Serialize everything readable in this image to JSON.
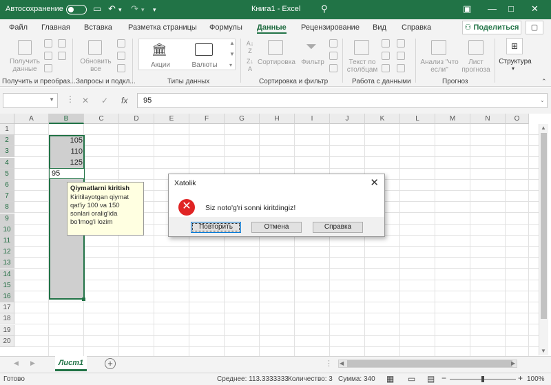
{
  "titlebar": {
    "autosave": "Автосохранение",
    "title": "Книга1  -  Excel"
  },
  "tabs": [
    "Файл",
    "Главная",
    "Вставка",
    "Разметка страницы",
    "Формулы",
    "Данные",
    "Рецензирование",
    "Вид",
    "Справка"
  ],
  "share": "Поделиться",
  "ribbon": {
    "get_data": "Получить данные",
    "refresh": "Обновить все",
    "stocks": "Акции",
    "currencies": "Валюты",
    "sort": "Сортировка",
    "filter": "Фильтр",
    "text_to_columns": "Текст по столбцам",
    "what_if": "Анализ \"что если\"",
    "forecast_sheet": "Лист прогноза",
    "outline": "Структура",
    "groups": [
      "Получить и преобраз...",
      "Запросы и подкл...",
      "Типы данных",
      "Сортировка и фильтр",
      "Работа с данными",
      "Прогноз"
    ]
  },
  "formula_value": "95",
  "columns": [
    "A",
    "B",
    "C",
    "D",
    "E",
    "F",
    "G",
    "H",
    "I",
    "J",
    "K",
    "L",
    "M",
    "N",
    "O"
  ],
  "rows": [
    "1",
    "2",
    "3",
    "4",
    "5",
    "6",
    "7",
    "8",
    "9",
    "10",
    "11",
    "12",
    "13",
    "14",
    "15",
    "16",
    "17",
    "18",
    "19",
    "20"
  ],
  "cells": {
    "b2": "105",
    "b3": "110",
    "b4": "125",
    "b5": "95"
  },
  "tooltip": {
    "title": "Qiymatlarni kiritish",
    "body": "Kiritilayotgan qiymat qat'iy 100 va 150 sonlari oralig'ida bo'lmog'i lozim"
  },
  "dialog": {
    "title": "Xatolik",
    "message": "Siz noto'g'ri sonni kiritdingiz!",
    "retry": "Повторить",
    "cancel": "Отмена",
    "help": "Справка"
  },
  "sheet": "Лист1",
  "status": {
    "ready": "Готово",
    "average": "Среднее: 113.3333333",
    "count": "Количество: 3",
    "sum": "Сумма: 340",
    "zoom": "100%"
  },
  "colors": {
    "accent": "#217346",
    "error": "#e02424"
  }
}
